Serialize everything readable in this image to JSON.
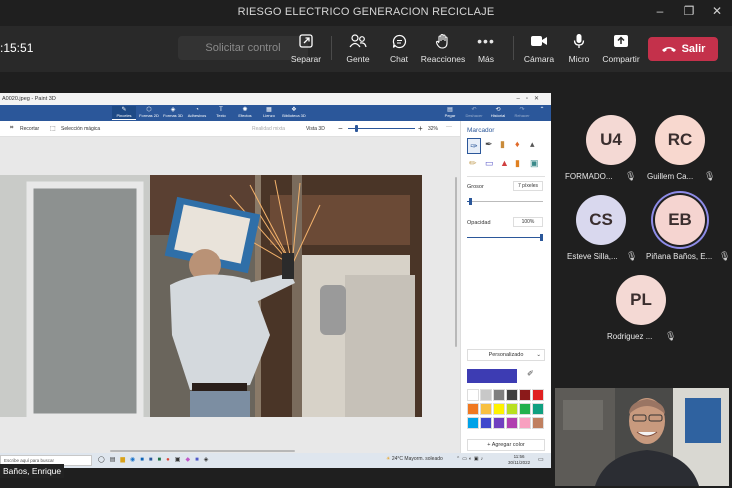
{
  "window": {
    "title": "RIESGO ELECTRICO GENERACION RECICLAJE",
    "controls": [
      "–",
      "❐",
      "✕"
    ]
  },
  "meeting": {
    "timer": ":15:51",
    "request_control": "Solicitar control",
    "toolbar": [
      {
        "label": "Separar",
        "icon": "popout-icon"
      },
      {
        "label": "Gente",
        "icon": "people-icon"
      },
      {
        "label": "Chat",
        "icon": "chat-icon"
      },
      {
        "label": "Reacciones",
        "icon": "raise-hand-icon"
      },
      {
        "label": "Más",
        "icon": "more-icon"
      },
      {
        "label": "Cámara",
        "icon": "camera-icon"
      },
      {
        "label": "Micro",
        "icon": "mic-icon"
      },
      {
        "label": "Compartir",
        "icon": "share-icon"
      }
    ],
    "leave_label": "Salir",
    "leave_color": "#c4314b"
  },
  "participants": [
    {
      "initials": "U4",
      "name": "FORMADO...",
      "color": "#f4d9d4"
    },
    {
      "initials": "RC",
      "name": "Guillem Ca...",
      "color": "#f8d8cf"
    },
    {
      "initials": "CS",
      "name": "Esteve Silla,...",
      "color": "#d9d8ee"
    },
    {
      "initials": "EB",
      "name": "Piñana Baños, E...",
      "color": "#f5d4d0"
    },
    {
      "initials": "PL",
      "name": "Rodriguez ...",
      "color": "#f4d9d4"
    }
  ],
  "presenter_label": "Baños, Enrique",
  "paint3d": {
    "title": "A0020.jpeg - Paint 3D",
    "ribbon": [
      "Pinceles",
      "Formas 2D",
      "Formas 3D",
      "Adhesivos",
      "Texto",
      "Efectos",
      "Lienzo",
      "Biblioteca 3D"
    ],
    "ribbon_right": [
      "Pegar",
      "Deshacer",
      "Historial",
      "Rehacer"
    ],
    "sub_left": [
      "Recortar",
      "Selección mágica"
    ],
    "sub_right": {
      "mixed_reality": "Realidad mixta",
      "view3d": "Vista 3D",
      "zoom": "32%"
    },
    "panel": {
      "title": "Marcador",
      "thickness_label": "Grosor",
      "thickness_value": "7 píxeles",
      "opacity_label": "Opacidad",
      "opacity_value": "100%",
      "custom_label": "Personalizado",
      "add_color": "Agregar color",
      "current_color": "#3d3cb3",
      "palette": [
        "#ffffff",
        "#c8c8c8",
        "#7f7f7f",
        "#404040",
        "#8b1a1a",
        "#e02020",
        "#f07820",
        "#f8c040",
        "#fff200",
        "#b8e020",
        "#22b14c",
        "#10a080",
        "#00a2e8",
        "#3f48cc",
        "#7040c0",
        "#b040b0",
        "#f8a0c0",
        "#c08060"
      ]
    },
    "taskbar": {
      "search": "Escribe aquí para buscar",
      "weather": "24°C Mayorm. soleado",
      "time": "11:56",
      "date": "30/11/2022"
    }
  }
}
